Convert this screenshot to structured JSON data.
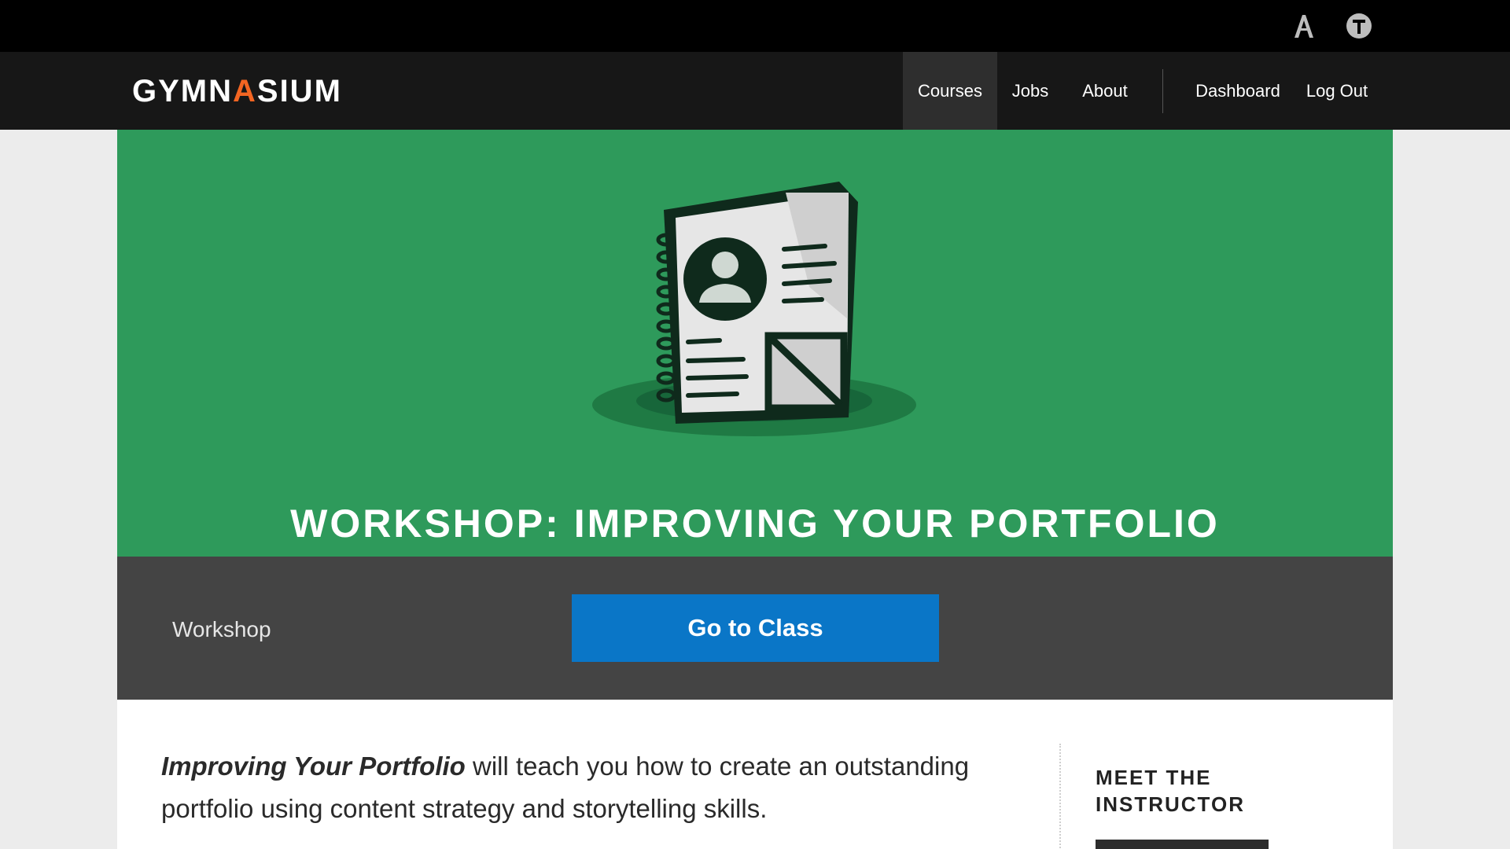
{
  "topbar": {
    "icons": [
      "adobe-a-icon",
      "t-circle-icon"
    ]
  },
  "navbar": {
    "logo_pre": "GYMN",
    "logo_accent": "A",
    "logo_post": "SIUM",
    "items": [
      {
        "label": "Courses",
        "active": true
      },
      {
        "label": "Jobs"
      },
      {
        "label": "About"
      },
      {
        "label": "Dashboard"
      },
      {
        "label": "Log Out"
      }
    ]
  },
  "hero": {
    "title": "WORKSHOP: IMPROVING YOUR PORTFOLIO",
    "background": "#2e9a5b",
    "illustration": "portfolio-notebook-icon"
  },
  "actionbar": {
    "type_label": "Workshop",
    "button_label": "Go to Class",
    "button_color": "#0a76c7"
  },
  "content": {
    "intro_em": "Improving Your Portfolio",
    "intro_rest": " will teach you how to create an outstanding portfolio using content strategy and storytelling skills.",
    "sidebar_heading": "MEET THE INSTRUCTOR"
  },
  "colors": {
    "accent": "#f26522",
    "topbar": "#000000",
    "navbar": "#171717",
    "actionbar": "#444444"
  }
}
